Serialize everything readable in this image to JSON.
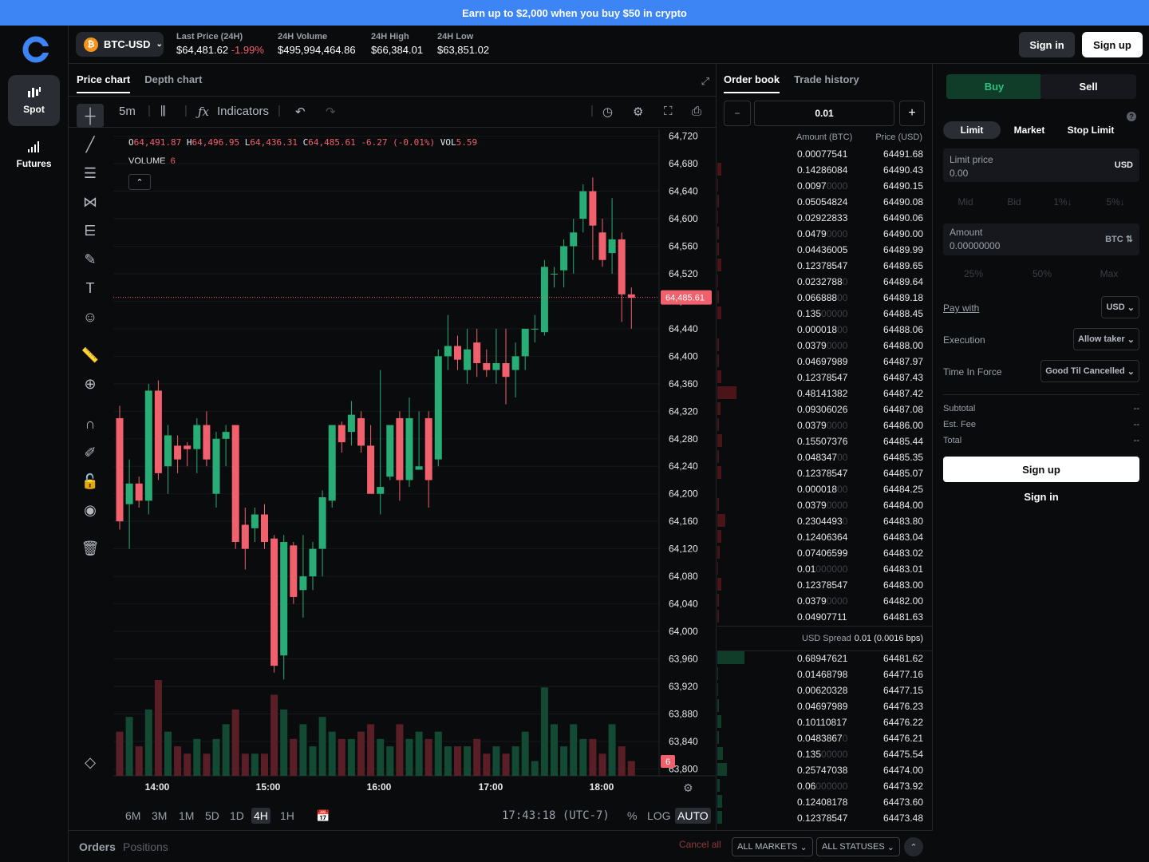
{
  "banner": "Earn up to $2,000 when you buy $50 in crypto",
  "rail": {
    "items": [
      {
        "label": "Spot"
      },
      {
        "label": "Futures"
      }
    ]
  },
  "header": {
    "pair": "BTC-USD",
    "stats": [
      {
        "label": "Last Price (24H)",
        "value": "$64,481.62",
        "change": "-1.99%"
      },
      {
        "label": "24H Volume",
        "value": "$495,994,464.86"
      },
      {
        "label": "24H High",
        "value": "$66,384.01"
      },
      {
        "label": "24H Low",
        "value": "$63,851.02"
      }
    ],
    "sign_in": "Sign in",
    "sign_up": "Sign up"
  },
  "chart_tabs": [
    "Price chart",
    "Depth chart"
  ],
  "toolbar": {
    "interval": "5m",
    "indicators": "Indicators"
  },
  "ohlc": {
    "o": "64,491.87",
    "h": "64,496.95",
    "l": "64,436.31",
    "c": "64,485.61",
    "chg": "-6.27 (-0.01%)",
    "vol": "5.59"
  },
  "volume_label": "VOLUME",
  "volume_value": "6",
  "chart_data": {
    "type": "candlestick",
    "y_ticks": [
      "64,720",
      "64,680",
      "64,640",
      "64,600",
      "64,560",
      "64,520",
      "64,480",
      "64,440",
      "64,400",
      "64,360",
      "64,320",
      "64,280",
      "64,240",
      "64,200",
      "64,160",
      "64,120",
      "64,080",
      "64,040",
      "64,000",
      "63,960",
      "63,920",
      "63,880",
      "63,840",
      "63,800"
    ],
    "x_ticks": [
      "14:00",
      "15:00",
      "16:00",
      "17:00",
      "18:00"
    ],
    "last_price_label": "64,485.61",
    "volume_badge": "6",
    "ylim": [
      63790,
      64730
    ],
    "candles": [
      [
        64310,
        64328,
        64148,
        64160,
        6
      ],
      [
        64185,
        64250,
        64120,
        64215,
        8
      ],
      [
        64215,
        64225,
        64180,
        64190,
        4
      ],
      [
        64190,
        64360,
        64170,
        64350,
        9
      ],
      [
        64350,
        64365,
        64220,
        64230,
        13
      ],
      [
        64240,
        64300,
        64200,
        64285,
        6
      ],
      [
        64270,
        64285,
        64230,
        64250,
        4
      ],
      [
        64270,
        64275,
        64240,
        64265,
        3
      ],
      [
        64265,
        64310,
        64230,
        64300,
        5
      ],
      [
        64300,
        64320,
        64240,
        64250,
        3
      ],
      [
        64200,
        64290,
        64180,
        64280,
        5
      ],
      [
        64280,
        64300,
        64240,
        64290,
        7
      ],
      [
        64300,
        64300,
        64120,
        64130,
        9
      ],
      [
        64155,
        64180,
        64090,
        64120,
        3
      ],
      [
        64150,
        64180,
        64130,
        64170,
        3
      ],
      [
        64170,
        64185,
        64120,
        64130,
        3
      ],
      [
        64135,
        64140,
        63940,
        63950,
        11
      ],
      [
        63965,
        64140,
        63930,
        64130,
        9
      ],
      [
        64125,
        64130,
        64040,
        64050,
        5
      ],
      [
        64060,
        64140,
        64020,
        64080,
        7
      ],
      [
        64080,
        64130,
        64060,
        64120,
        4
      ],
      [
        64120,
        64205,
        64080,
        64195,
        8
      ],
      [
        64190,
        64300,
        64180,
        64300,
        6
      ],
      [
        64300,
        64305,
        64260,
        64275,
        5
      ],
      [
        64290,
        64335,
        64270,
        64315,
        5
      ],
      [
        64310,
        64320,
        64260,
        64270,
        6
      ],
      [
        64270,
        64300,
        64200,
        64200,
        7
      ],
      [
        64200,
        64380,
        64170,
        64210,
        5
      ],
      [
        64225,
        64280,
        64220,
        64300,
        4
      ],
      [
        64310,
        64320,
        64190,
        64220,
        7
      ],
      [
        64220,
        64340,
        64210,
        64310,
        5
      ],
      [
        64235,
        64320,
        64240,
        64240,
        6
      ],
      [
        64310,
        64320,
        64180,
        64220,
        5
      ],
      [
        64250,
        64410,
        64240,
        64400,
        6
      ],
      [
        64400,
        64460,
        64380,
        64415,
        4
      ],
      [
        64415,
        64430,
        64380,
        64395,
        4
      ],
      [
        64380,
        64440,
        64360,
        64410,
        4
      ],
      [
        64420,
        64440,
        64370,
        64390,
        5
      ],
      [
        64390,
        64410,
        64370,
        64380,
        3
      ],
      [
        64380,
        64440,
        64360,
        64390,
        4
      ],
      [
        64390,
        64440,
        64330,
        64370,
        3
      ],
      [
        64380,
        64420,
        64340,
        64400,
        4
      ],
      [
        64400,
        64440,
        64380,
        64440,
        6
      ],
      [
        64440,
        64460,
        64420,
        64440,
        2
      ],
      [
        64435,
        64540,
        64430,
        64530,
        12
      ],
      [
        64520,
        64530,
        64500,
        64520,
        7
      ],
      [
        64525,
        64570,
        64500,
        64560,
        4
      ],
      [
        64560,
        64600,
        64520,
        64580,
        7
      ],
      [
        64600,
        64650,
        64580,
        64640,
        5
      ],
      [
        64640,
        64660,
        64540,
        64590,
        5
      ],
      [
        64580,
        64600,
        64530,
        64540,
        3
      ],
      [
        64550,
        64630,
        64520,
        64570,
        7
      ],
      [
        64570,
        64580,
        64450,
        64490,
        4
      ],
      [
        64490,
        64500,
        64440,
        64485,
        2
      ]
    ]
  },
  "bottom": {
    "ranges": [
      "6M",
      "3M",
      "1M",
      "5D",
      "1D",
      "4H",
      "1H"
    ],
    "active": "4H",
    "clock": "17:43:18 (UTC-7)",
    "pct": "%",
    "log": "LOG",
    "auto": "AUTO"
  },
  "orders_bar": {
    "orders": "Orders",
    "positions": "Positions",
    "cancel_all": "Cancel all",
    "markets": "ALL MARKETS",
    "statuses": "ALL STATUSES"
  },
  "book": {
    "tabs": [
      "Order book",
      "Trade history"
    ],
    "increment": "0.01",
    "header_amount": "Amount (BTC)",
    "header_price": "Price (USD)",
    "asks": [
      [
        "0.00077541",
        "",
        "64491.68",
        0
      ],
      [
        "0.14286084",
        "",
        "64490.43",
        5
      ],
      [
        "0.0097",
        "0000",
        "64490.15",
        1
      ],
      [
        "0.05054824",
        "",
        "64490.08",
        2
      ],
      [
        "0.02922833",
        "",
        "64490.06",
        1
      ],
      [
        "0.0479",
        "0000",
        "64490.00",
        2
      ],
      [
        "0.04436005",
        "",
        "64489.99",
        2
      ],
      [
        "0.12378547",
        "",
        "64489.65",
        5
      ],
      [
        "0.0232788",
        "0",
        "64489.64",
        1
      ],
      [
        "0.066888",
        "00",
        "64489.18",
        2
      ],
      [
        "0.135",
        "00000",
        "64488.45",
        5
      ],
      [
        "0.000018",
        "00",
        "64488.06",
        0
      ],
      [
        "0.0379",
        "0000",
        "64488.00",
        2
      ],
      [
        "0.04697989",
        "",
        "64487.97",
        2
      ],
      [
        "0.12378547",
        "",
        "64487.43",
        5
      ],
      [
        "0.48141382",
        "",
        "64487.42",
        24
      ],
      [
        "0.09306026",
        "",
        "64487.08",
        4
      ],
      [
        "0.0379",
        "0000",
        "64486.00",
        2
      ],
      [
        "0.15507376",
        "",
        "64485.44",
        6
      ],
      [
        "0.048347",
        "00",
        "64485.35",
        2
      ],
      [
        "0.12378547",
        "",
        "64485.07",
        5
      ],
      [
        "0.000018",
        "00",
        "64484.25",
        0
      ],
      [
        "0.0379",
        "0000",
        "64484.00",
        2
      ],
      [
        "0.2304493",
        "0",
        "64483.80",
        10
      ],
      [
        "0.12406364",
        "",
        "64483.04",
        5
      ],
      [
        "0.07406599",
        "",
        "64483.02",
        3
      ],
      [
        "0.01",
        "000000",
        "64483.01",
        1
      ],
      [
        "0.12378547",
        "",
        "64483.00",
        5
      ],
      [
        "0.0379",
        "0000",
        "64482.00",
        2
      ],
      [
        "0.04907711",
        "",
        "64481.63",
        2
      ]
    ],
    "spread_label": "USD Spread",
    "spread_value": "0.01 (0.0016 bps)",
    "bids": [
      [
        "0.68947621",
        "",
        "64481.62",
        34
      ],
      [
        "0.01468798",
        "",
        "64477.16",
        1
      ],
      [
        "0.00620328",
        "",
        "64477.15",
        1
      ],
      [
        "0.04697989",
        "",
        "64476.23",
        2
      ],
      [
        "0.10110817",
        "",
        "64476.22",
        5
      ],
      [
        "0.0483867",
        "0",
        "64476.21",
        2
      ],
      [
        "0.135",
        "00000",
        "64475.54",
        7
      ],
      [
        "0.25747038",
        "",
        "64474.00",
        12
      ],
      [
        "0.06",
        "000000",
        "64473.92",
        3
      ],
      [
        "0.12408178",
        "",
        "64473.60",
        6
      ],
      [
        "0.12378547",
        "",
        "64473.48",
        6
      ]
    ]
  },
  "trade": {
    "buy": "Buy",
    "sell": "Sell",
    "types": [
      "Limit",
      "Market",
      "Stop Limit"
    ],
    "limit_price_label": "Limit price",
    "limit_price_value": "0.00",
    "limit_price_unit": "USD",
    "price_chips": [
      "Mid",
      "Bid",
      "1%↓",
      "5%↓"
    ],
    "amount_label": "Amount",
    "amount_value": "0.00000000",
    "amount_unit": "BTC",
    "amount_chips": [
      "25%",
      "50%",
      "Max"
    ],
    "pay_with": "Pay with",
    "pay_currency": "USD",
    "execution": "Execution",
    "execution_value": "Allow taker",
    "tif": "Time In Force",
    "tif_value": "Good Til Cancelled",
    "subtotal": "Subtotal",
    "fee": "Est. Fee",
    "total": "Total",
    "dash": "--",
    "sign_up": "Sign up",
    "sign_in": "Sign in"
  },
  "colors": {
    "up": "#27ad75",
    "down": "#f0616d",
    "accent": "#3d84f5"
  }
}
